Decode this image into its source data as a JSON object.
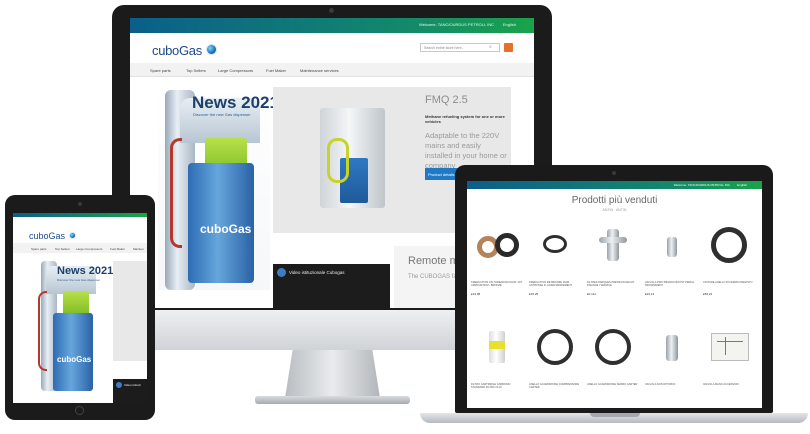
{
  "topbar": {
    "welcome": "Welcome, TANCIOURDUS PETROLL INC",
    "language": "English"
  },
  "site": {
    "logo_text": "cuboGas"
  },
  "search": {
    "placeholder": "Search entire store here..."
  },
  "nav": {
    "items": [
      "Spare parts",
      "Top Sellers",
      "Large Compressors",
      "Fuel Maker",
      "Maintenance services"
    ]
  },
  "hero": {
    "title": "News 2021",
    "subtitle": "Discover the new Gas dispenser",
    "dispenser_brand": "cuboGas"
  },
  "fmq": {
    "title": "FMQ 2.5",
    "description": "Methane refueling system for one or more vehicles",
    "text": "Adaptable to the 220V mains and easily installed in your home or company",
    "button": "Product details"
  },
  "video": {
    "title": "Video istituzionale Cubogas"
  },
  "remote": {
    "title": "Remote ma",
    "text": "The CUBOGAS fa the parameters f"
  },
  "tablet": {
    "logo_text": "cuboGas",
    "nav_items": [
      "Spare parts",
      "Top Sellers",
      "Large Compressors",
      "Fuel Maker",
      "Mainten"
    ],
    "hero_title": "News 2021",
    "hero_subtitle": "Discover the new Gas dispenser",
    "dispenser_brand": "cuboGas",
    "video_title": "Video istituzi"
  },
  "laptop": {
    "welcome": "Welcome, TANCIOURDUS PETROLL INC",
    "language": "English",
    "heading": "Prodotti più venduti",
    "subheading": "ANTIN · ANTIN",
    "products": [
      {
        "name": "KREDUCTION ON THREADING DIAM. VAT. ARMOUR BLM - BRONZE",
        "price": "£19,98"
      },
      {
        "name": "KREDUCTION DE BRONZE DIAM. ANTRUSSE R. ACIER RENDEMENT",
        "price": "£15,25"
      },
      {
        "name": "FILTRES PARQUES PRESSION RECHT FINANCE / SERVICE",
        "price": "£0,114"
      },
      {
        "name": "VALVOLA PRIO BINARIO BOOST PERIAL RIFORNIMENT",
        "price": "£29,13"
      },
      {
        "name": "CINTURE ANELLO DI FERMO PREVISTO",
        "price": "£58,24"
      },
      {
        "name": "FILTRO CARTRIDGE CARBONIO STANDARD FILTRO OLIO",
        "price": ""
      },
      {
        "name": "ANELLO GUARNIZIONE COMPRESSORE CARTER",
        "price": ""
      },
      {
        "name": "ANELLO GUARNIZIONE FERMO CARTER",
        "price": ""
      },
      {
        "name": "VALVOLA NON RITORNO",
        "price": ""
      },
      {
        "name": "VALVOLA MANO ACCESSORI",
        "price": ""
      }
    ]
  },
  "colors": {
    "brand_blue": "#1c4a8c",
    "cta_blue": "#1f79c4",
    "green": "#1aa34a",
    "cart_orange": "#e4702a"
  }
}
